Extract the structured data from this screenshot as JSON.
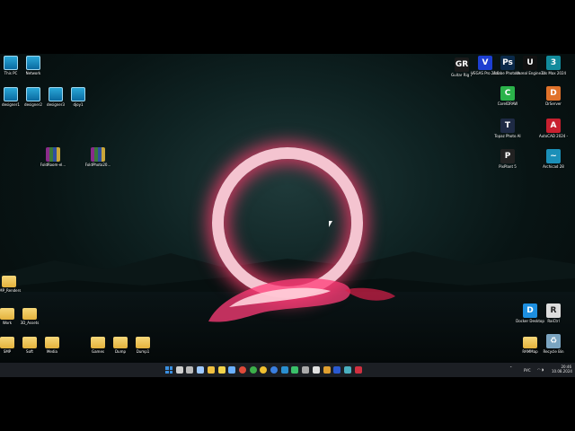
{
  "desktop_icons": [
    {
      "label": "This PC",
      "type": "monitor"
    },
    {
      "label": "Network",
      "type": "monitor"
    },
    {
      "label": "designer1",
      "type": "monitor"
    },
    {
      "label": "designer2",
      "type": "monitor"
    },
    {
      "label": "designer3",
      "type": "monitor"
    },
    {
      "label": "djoy1",
      "type": "monitor"
    },
    {
      "label": "FoldRoom-el...",
      "type": "rar"
    },
    {
      "label": "FoldPhoto20...",
      "type": "rar"
    },
    {
      "label": "SMP_Renders",
      "type": "folder"
    },
    {
      "label": "Work",
      "type": "folder"
    },
    {
      "label": "3D_Assets",
      "type": "folder"
    },
    {
      "label": "SMP",
      "type": "folder"
    },
    {
      "label": "Soft",
      "type": "folder"
    },
    {
      "label": "Media",
      "type": "folder"
    },
    {
      "label": "Games",
      "type": "folder"
    },
    {
      "label": "Dump",
      "type": "folder"
    },
    {
      "label": "Dump1",
      "type": "folder"
    },
    {
      "label": "Guitar Rig 7",
      "type": "app",
      "glyph": "GR",
      "color": "#1b1b1b"
    },
    {
      "label": "VEGAS Pro 22.0",
      "type": "app",
      "glyph": "V",
      "color": "#1d3fd1"
    },
    {
      "label": "Adobe Photosh...",
      "type": "app",
      "glyph": "Ps",
      "color": "#0b2a4a"
    },
    {
      "label": "Unreal Engine 5.4.0",
      "type": "app",
      "glyph": "U",
      "color": "#111111"
    },
    {
      "label": "3ds Max 2024",
      "type": "app",
      "glyph": "3",
      "color": "#128b9c"
    },
    {
      "label": "CorelDRAW",
      "type": "app",
      "glyph": "C",
      "color": "#2bb34a"
    },
    {
      "label": "DrServer",
      "type": "app",
      "glyph": "D",
      "color": "#e0722a"
    },
    {
      "label": "Topaz Photo AI",
      "type": "app",
      "glyph": "T",
      "color": "#1e2a44"
    },
    {
      "label": "AutoCAD 2024 - E...",
      "type": "app",
      "glyph": "A",
      "color": "#c8202f"
    },
    {
      "label": "PixPlant 5",
      "type": "app",
      "glyph": "P",
      "color": "#222222"
    },
    {
      "label": "Archicad 28",
      "type": "app",
      "glyph": "~",
      "color": "#1b8fb8"
    },
    {
      "label": "Docker Desktop",
      "type": "app",
      "glyph": "D",
      "color": "#1d8fe0"
    },
    {
      "label": "RaiCtrl",
      "type": "app",
      "glyph": "R",
      "color": "#dddddd"
    },
    {
      "label": "RAMMap",
      "type": "folder"
    },
    {
      "label": "Recycle Bin",
      "type": "app",
      "glyph": "♻",
      "color": "#7aa4c0"
    }
  ],
  "taskbar": {
    "apps": [
      {
        "name": "start-button",
        "color": "#3a8fe0"
      },
      {
        "name": "search-icon",
        "color": "#cfcfcf"
      },
      {
        "name": "task-view-icon",
        "color": "#bbbbbb"
      },
      {
        "name": "widgets-icon",
        "color": "#9ec9ff"
      },
      {
        "name": "file-explorer-icon",
        "color": "#f0c040"
      },
      {
        "name": "store-icon",
        "color": "#f2d34a"
      },
      {
        "name": "media-icon",
        "color": "#6ab0ff"
      },
      {
        "name": "chrome-icon",
        "color": "#e04a3a"
      },
      {
        "name": "chrome-icon-2",
        "color": "#3cb04a"
      },
      {
        "name": "chrome-icon-3",
        "color": "#f0c030"
      },
      {
        "name": "chrome-icon-4",
        "color": "#3a7fe0"
      },
      {
        "name": "app-icon-blue",
        "color": "#2a8fd0"
      },
      {
        "name": "app-icon-green",
        "color": "#3ac06a"
      },
      {
        "name": "app-icon-grey",
        "color": "#aaaaaa"
      },
      {
        "name": "app-icon-dark",
        "color": "#e0e0e0"
      },
      {
        "name": "app-icon-orange",
        "color": "#e0a030"
      },
      {
        "name": "app-icon-navy",
        "color": "#2a5ad0"
      },
      {
        "name": "app-icon-teal",
        "color": "#4ab0c0"
      },
      {
        "name": "app-icon-red",
        "color": "#d03040"
      }
    ],
    "tray": {
      "lang": "РУС",
      "time": "20:46",
      "date": "10.08.2024"
    }
  }
}
